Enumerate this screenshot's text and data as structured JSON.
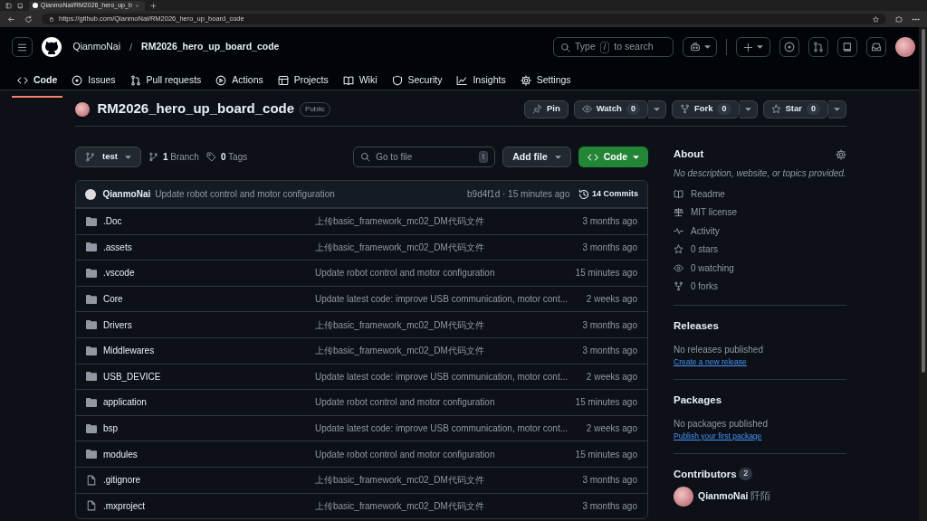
{
  "browser": {
    "tab_title": "QianmoNai/RM2026_hero_up_b",
    "url": "https://github.com/QianmoNai/RM2026_hero_up_board_code"
  },
  "header": {
    "owner": "QianmoNai",
    "separator": "/",
    "repo": "RM2026_hero_up_board_code",
    "search_prefix": "Type",
    "search_key": "/",
    "search_suffix": "to search"
  },
  "tabs": [
    {
      "kind": "code",
      "label": "Code",
      "selected": true
    },
    {
      "kind": "issue",
      "label": "Issues",
      "selected": false
    },
    {
      "kind": "pr",
      "label": "Pull requests",
      "selected": false
    },
    {
      "kind": "play",
      "label": "Actions",
      "selected": false
    },
    {
      "kind": "table",
      "label": "Projects",
      "selected": false
    },
    {
      "kind": "book",
      "label": "Wiki",
      "selected": false
    },
    {
      "kind": "shield",
      "label": "Security",
      "selected": false
    },
    {
      "kind": "graph",
      "label": "Insights",
      "selected": false
    },
    {
      "kind": "gear",
      "label": "Settings",
      "selected": false
    }
  ],
  "repo": {
    "name": "RM2026_hero_up_board_code",
    "visibility": "Public",
    "actions": [
      {
        "kind": "pin",
        "label": "Pin"
      },
      {
        "kind": "eye",
        "label": "Watch",
        "count": "0"
      },
      {
        "kind": "fork",
        "label": "Fork",
        "count": "0"
      },
      {
        "kind": "star",
        "label": "Star",
        "count": "0"
      }
    ]
  },
  "toolbar": {
    "branch": "test",
    "branch_count": "1",
    "branch_label": "Branch",
    "tag_count": "0",
    "tag_label": "Tags",
    "goto_placeholder": "Go to file",
    "goto_key": "t",
    "add_file": "Add file",
    "code": "Code"
  },
  "commit": {
    "author": "QianmoNai",
    "message": "Update robot control and motor configuration",
    "meta": "b9d4f1d · 15 minutes ago",
    "commits": "14 Commits"
  },
  "files": [
    {
      "kind": "folder",
      "name": ".Doc",
      "message": "上传basic_framework_mc02_DM代码文件",
      "time": "3 months ago"
    },
    {
      "kind": "folder",
      "name": ".assets",
      "message": "上传basic_framework_mc02_DM代码文件",
      "time": "3 months ago"
    },
    {
      "kind": "folder",
      "name": ".vscode",
      "message": "Update robot control and motor configuration",
      "time": "15 minutes ago"
    },
    {
      "kind": "folder",
      "name": "Core",
      "message": "Update latest code: improve USB communication, motor cont...",
      "time": "2 weeks ago"
    },
    {
      "kind": "folder",
      "name": "Drivers",
      "message": "上传basic_framework_mc02_DM代码文件",
      "time": "3 months ago"
    },
    {
      "kind": "folder",
      "name": "Middlewares",
      "message": "上传basic_framework_mc02_DM代码文件",
      "time": "3 months ago"
    },
    {
      "kind": "folder",
      "name": "USB_DEVICE",
      "message": "Update latest code: improve USB communication, motor cont...",
      "time": "2 weeks ago"
    },
    {
      "kind": "folder",
      "name": "application",
      "message": "Update robot control and motor configuration",
      "time": "15 minutes ago"
    },
    {
      "kind": "folder",
      "name": "bsp",
      "message": "Update latest code: improve USB communication, motor cont...",
      "time": "2 weeks ago"
    },
    {
      "kind": "folder",
      "name": "modules",
      "message": "Update robot control and motor configuration",
      "time": "15 minutes ago"
    },
    {
      "kind": "file",
      "name": ".gitignore",
      "message": "上传basic_framework_mc02_DM代码文件",
      "time": "3 months ago"
    },
    {
      "kind": "file",
      "name": ".mxproject",
      "message": "上传basic_framework_mc02_DM代码文件",
      "time": "3 months ago"
    }
  ],
  "about": {
    "title": "About",
    "description": "No description, website, or topics provided.",
    "links": [
      {
        "kind": "book",
        "label": "Readme"
      },
      {
        "kind": "scale",
        "label": "MIT license"
      },
      {
        "kind": "pulse",
        "label": "Activity"
      },
      {
        "kind": "star",
        "label": "0 stars"
      },
      {
        "kind": "eye",
        "label": "0 watching"
      },
      {
        "kind": "fork",
        "label": "0 forks"
      }
    ]
  },
  "releases": {
    "title": "Releases",
    "text": "No releases published",
    "link": "Create a new release"
  },
  "packages": {
    "title": "Packages",
    "text": "No packages published",
    "link": "Publish your first package"
  },
  "contributors": {
    "title": "Contributors",
    "count": "2",
    "people": [
      {
        "login": "QianmoNai",
        "display": "阡陌"
      }
    ]
  }
}
